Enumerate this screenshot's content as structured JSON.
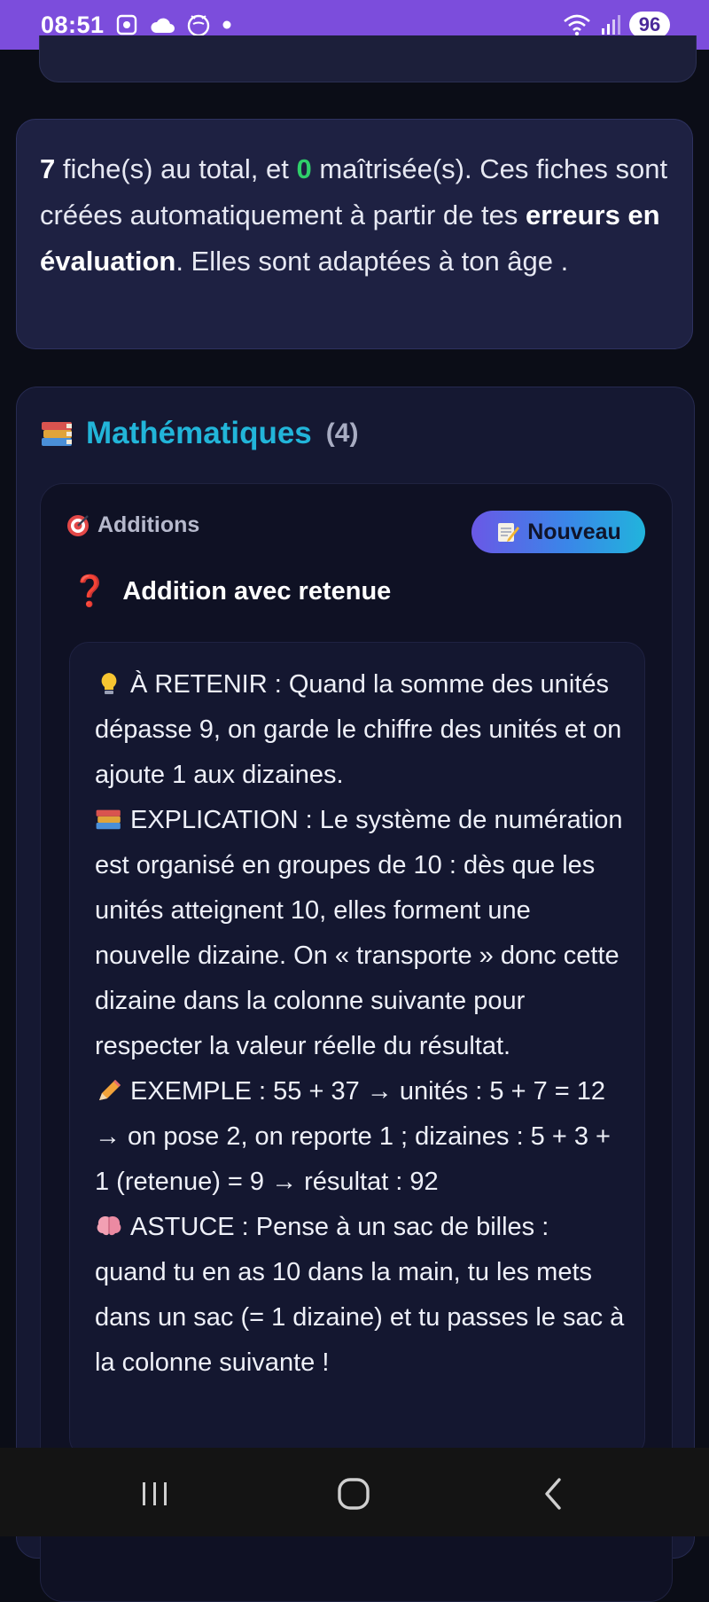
{
  "status_bar": {
    "time": "08:51",
    "battery": "96",
    "icons": [
      "screenshot-icon",
      "cloud-icon",
      "app-icon",
      "dot-icon",
      "wifi-icon",
      "signal-icon"
    ]
  },
  "info": {
    "total_count": "7",
    "text_1": " fiche(s) au total, et ",
    "mastered_count": "0",
    "text_2": " maîtrisée(s). Ces fiches sont créées automatiquement à partir de tes ",
    "bold_text": "erreurs en évaluation",
    "text_3": ". Elles sont adaptées à ton âge ."
  },
  "subject": {
    "icon": "books-icon",
    "title": "Mathématiques",
    "count": "(4)"
  },
  "fiche": {
    "topic_icon": "target-icon",
    "topic": "Additions",
    "badge_icon": "memo-icon",
    "badge": "Nouveau",
    "question_icon": "question-mark-icon",
    "question": "Addition avec retenue",
    "sections": [
      {
        "icon": "lightbulb-icon",
        "text": "À RETENIR : Quand la somme des unités dépasse 9, on garde le chiffre des unités et on ajoute 1 aux dizaines."
      },
      {
        "icon": "books-icon",
        "text": "EXPLICATION : Le système de numération est organisé en groupes de 10 : dès que les unités atteignent 10, elles forment une nouvelle dizaine. On « transporte » donc cette dizaine dans la colonne suivante pour respecter la valeur réelle du résultat."
      },
      {
        "icon": "pencil-icon",
        "text": "EXEMPLE : 55 + 37 → unités : 5 + 7 = 12 → on pose 2, on reporte 1 ; dizaines : 5 + 3 + 1 (retenue) = 9 → résultat : 92"
      },
      {
        "icon": "brain-icon",
        "text": "ASTUCE : Pense à un sac de billes : quand tu en as 10 dans la main, tu les mets dans un sac (= 1 dizaine) et tu passes le sac à la colonne suivante !"
      }
    ]
  },
  "colors": {
    "status_bar": "#7c4ddc",
    "accent_title": "#22b5d9",
    "mastered_green": "#2fd06a",
    "background": "#0b0d17"
  }
}
